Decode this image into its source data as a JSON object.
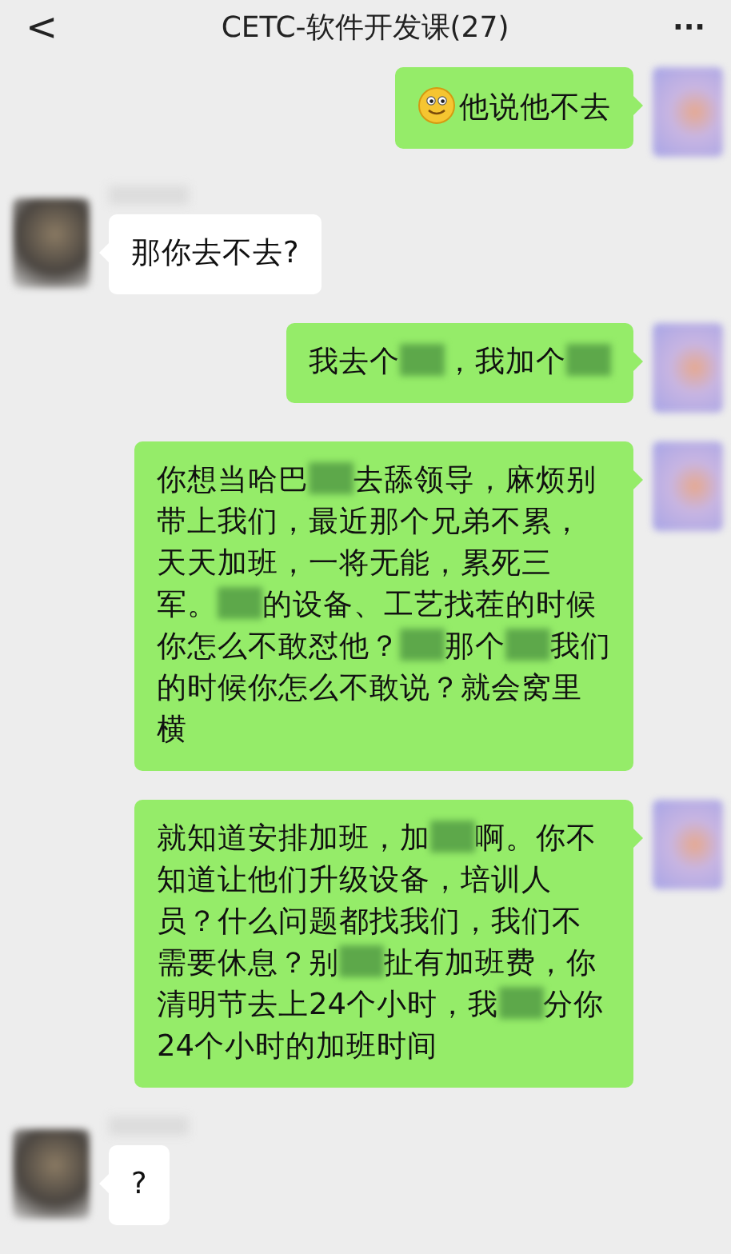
{
  "header": {
    "back": "<",
    "title": "CETC-软件开发课(27)",
    "more": "···"
  },
  "messages": [
    {
      "kind": "sent",
      "parts": [
        {
          "kind": "emoji"
        },
        {
          "kind": "text",
          "text": "他说他不去"
        }
      ]
    },
    {
      "kind": "received",
      "parts": [
        {
          "kind": "text",
          "text": "那你去不去?"
        }
      ]
    },
    {
      "kind": "sent",
      "parts": [
        {
          "kind": "text",
          "text": "我去个"
        },
        {
          "kind": "censor"
        },
        {
          "kind": "text",
          "text": "，我加个"
        },
        {
          "kind": "censor"
        }
      ]
    },
    {
      "kind": "sent",
      "parts": [
        {
          "kind": "text",
          "text": "你想当哈巴"
        },
        {
          "kind": "censor"
        },
        {
          "kind": "text",
          "text": "去舔领导，麻烦别带上我们，最近那个兄弟不累，天天加班，一将无能，累死三军。"
        },
        {
          "kind": "censor"
        },
        {
          "kind": "text",
          "text": "的设备、工艺找茬的时候你怎么不敢怼他？"
        },
        {
          "kind": "censor"
        },
        {
          "kind": "text",
          "text": "那个"
        },
        {
          "kind": "censor"
        },
        {
          "kind": "text",
          "text": "我们的时候你怎么不敢说？就会窝里横"
        }
      ]
    },
    {
      "kind": "sent",
      "parts": [
        {
          "kind": "text",
          "text": "就知道安排加班，加"
        },
        {
          "kind": "censor"
        },
        {
          "kind": "text",
          "text": "啊。你不知道让他们升级设备，培训人员？什么问题都找我们，我们不需要休息？别"
        },
        {
          "kind": "censor"
        },
        {
          "kind": "text",
          "text": "扯有加班费，你清明节去上24个小时，我"
        },
        {
          "kind": "censor"
        },
        {
          "kind": "text",
          "text": "分你24个小时的加班时间"
        }
      ]
    },
    {
      "kind": "received",
      "parts": [
        {
          "kind": "text",
          "text": "?"
        }
      ]
    }
  ]
}
